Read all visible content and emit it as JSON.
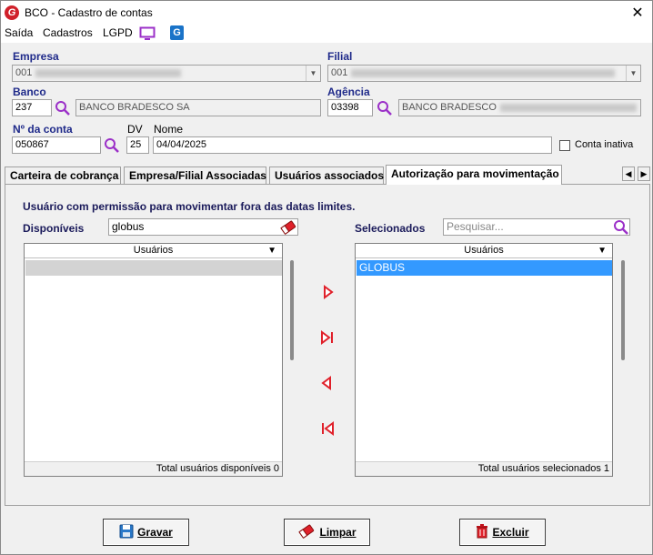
{
  "window": {
    "title": "BCO - Cadastro de contas",
    "logo_letter": "G",
    "close_glyph": "✕"
  },
  "menu": {
    "items": [
      "Saída",
      "Cadastros",
      "LGPD"
    ]
  },
  "form": {
    "empresa_label": "Empresa",
    "empresa_value": "001",
    "filial_label": "Filial",
    "filial_value": "001",
    "banco_label": "Banco",
    "banco_code": "237",
    "banco_name": "BANCO BRADESCO SA",
    "agencia_label": "Agência",
    "agencia_code": "03398",
    "agencia_name": "BANCO BRADESCO",
    "conta_label": "Nº da conta",
    "conta_value": "050867",
    "dv_label": "DV",
    "dv_value": "25",
    "nome_label": "Nome",
    "nome_value": "04/04/2025",
    "conta_inativa_label": "Conta inativa",
    "conta_inativa_checked": false
  },
  "tabs": [
    {
      "label": "Carteira de cobrança",
      "active": false
    },
    {
      "label": "Empresa/Filial Associadas",
      "active": false
    },
    {
      "label": "Usuários associados",
      "active": false
    },
    {
      "label": "Autorização para movimentação",
      "active": true
    }
  ],
  "panel": {
    "description": "Usuário com permissão para movimentar fora das datas limites.",
    "disponiveis_label": "Disponíveis",
    "disponiveis_filter": "globus",
    "selecionados_label": "Selecionados",
    "selecionados_placeholder": "Pesquisar...",
    "left_list": {
      "header": "Usuários",
      "rows": [
        ""
      ],
      "footer": "Total usuários disponíveis 0"
    },
    "right_list": {
      "header": "Usuários",
      "rows": [
        "GLOBUS"
      ],
      "footer": "Total usuários selecionados 1"
    }
  },
  "buttons": {
    "gravar": "Gravar",
    "limpar": "Limpar",
    "excluir": "Excluir"
  },
  "colors": {
    "accent_blue": "#1f2a8a",
    "selection": "#3399ff",
    "red": "#e0202a",
    "purple": "#9b30c8"
  }
}
